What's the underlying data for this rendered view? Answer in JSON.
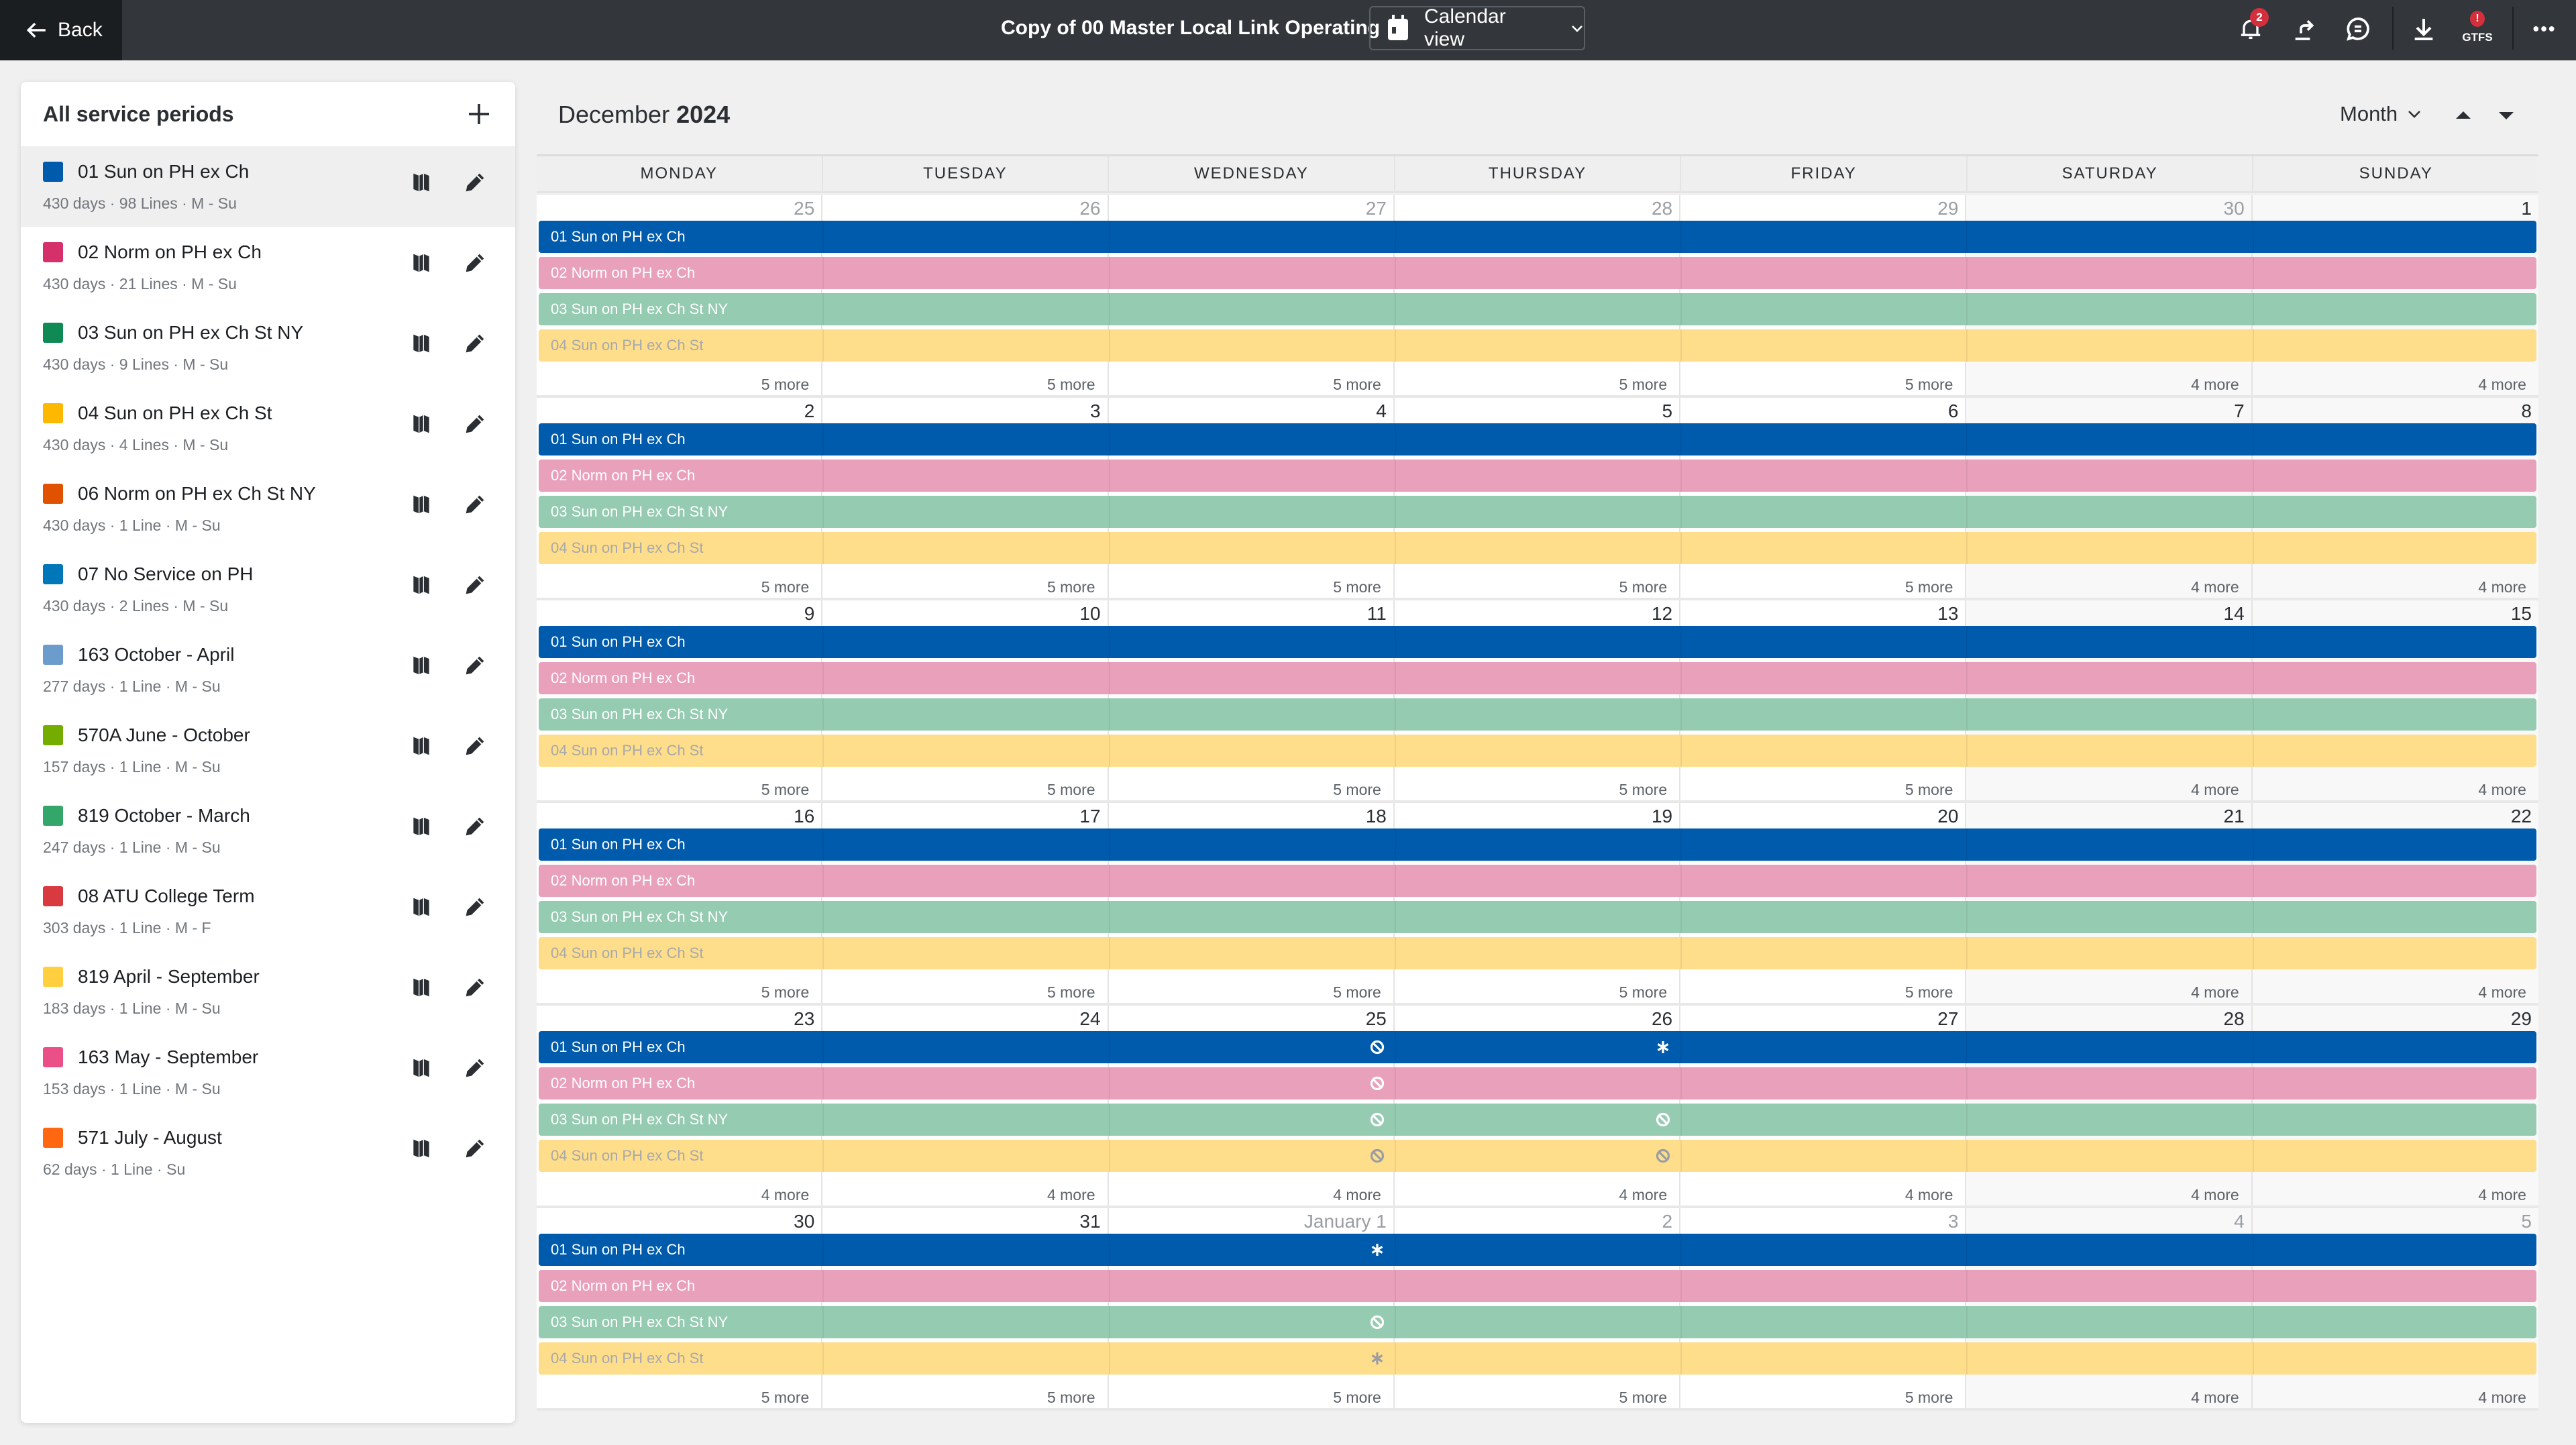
{
  "topbar": {
    "back_label": "Back",
    "doc_title": "Copy of 00 Master Local Link Operating",
    "view_label": "Calendar view",
    "notifications_count": "2",
    "gtfs_label": "GTFS",
    "gtfs_badge": "!",
    "icons": [
      "bell-icon",
      "share-icon",
      "comment-icon",
      "download-icon",
      "gtfs-icon",
      "more-icon"
    ]
  },
  "sidebar": {
    "title": "All service periods",
    "items": [
      {
        "name": "01 Sun on PH ex Ch",
        "meta": "430 days · 98 Lines · M - Su",
        "color": "#005bac",
        "selected": true
      },
      {
        "name": "02 Norm on PH ex Ch",
        "meta": "430 days · 21 Lines · M - Su",
        "color": "#d5306a"
      },
      {
        "name": "03 Sun on PH ex Ch St NY",
        "meta": "430 days · 9 Lines · M - Su",
        "color": "#0f8a55"
      },
      {
        "name": "04 Sun on PH ex Ch St",
        "meta": "430 days · 4 Lines · M - Su",
        "color": "#ffb800"
      },
      {
        "name": "06 Norm on PH ex Ch St NY",
        "meta": "430 days · 1 Line · M - Su",
        "color": "#e05200"
      },
      {
        "name": "07 No Service on PH",
        "meta": "430 days · 2 Lines · M - Su",
        "color": "#0077b8"
      },
      {
        "name": "163 October - April",
        "meta": "277 days · 1 Line · M - Su",
        "color": "#6b9ccb"
      },
      {
        "name": "570A June - October",
        "meta": "157 days · 1 Line · M - Su",
        "color": "#74ad00"
      },
      {
        "name": "819 October - March",
        "meta": "247 days · 1 Line · M - Su",
        "color": "#35a66a"
      },
      {
        "name": "08 ATU College Term",
        "meta": "303 days · 1 Line · M - F",
        "color": "#d93a3f"
      },
      {
        "name": "819 April - September",
        "meta": "183 days · 1 Line · M - Su",
        "color": "#ffcf3f"
      },
      {
        "name": "163 May - September",
        "meta": "153 days · 1 Line · M - Su",
        "color": "#ea4f88"
      },
      {
        "name": "571 July - August",
        "meta": "62 days · 1 Line · Su",
        "color": "#ff6711"
      }
    ]
  },
  "calendar": {
    "month": "December",
    "year": "2024",
    "view_select": "Month",
    "weekdays": [
      "MONDAY",
      "TUESDAY",
      "WEDNESDAY",
      "THURSDAY",
      "FRIDAY",
      "SATURDAY",
      "SUNDAY"
    ],
    "bars": [
      {
        "label": "01 Sun on PH ex Ch",
        "color": "#005bac",
        "text_color": "#ffffff",
        "mark_color": "#ffffff"
      },
      {
        "label": "02 Norm on PH ex Ch",
        "color": "#e9a1bb",
        "text_color": "#ffffff",
        "mark_color": "#ffffff"
      },
      {
        "label": "03 Sun on PH ex Ch St NY",
        "color": "#95cbb1",
        "text_color": "#ffffff",
        "mark_color": "#ffffff"
      },
      {
        "label": "04 Sun on PH ex Ch St",
        "color": "#fedd8b",
        "text_color": "#a7a9ab",
        "mark_color": "#9a9ea3"
      }
    ],
    "weeks": [
      {
        "days": [
          {
            "num": "25",
            "muted": true,
            "more": "5 more"
          },
          {
            "num": "26",
            "muted": true,
            "more": "5 more"
          },
          {
            "num": "27",
            "muted": true,
            "more": "5 more"
          },
          {
            "num": "28",
            "muted": true,
            "more": "5 more"
          },
          {
            "num": "29",
            "muted": true,
            "more": "5 more"
          },
          {
            "num": "30",
            "muted": true,
            "more": "4 more"
          },
          {
            "num": "1",
            "more": "4 more"
          }
        ]
      },
      {
        "days": [
          {
            "num": "2",
            "more": "5 more"
          },
          {
            "num": "3",
            "more": "5 more"
          },
          {
            "num": "4",
            "more": "5 more"
          },
          {
            "num": "5",
            "more": "5 more"
          },
          {
            "num": "6",
            "more": "5 more"
          },
          {
            "num": "7",
            "more": "4 more"
          },
          {
            "num": "8",
            "more": "4 more"
          }
        ]
      },
      {
        "days": [
          {
            "num": "9",
            "more": "5 more"
          },
          {
            "num": "10",
            "more": "5 more"
          },
          {
            "num": "11",
            "more": "5 more"
          },
          {
            "num": "12",
            "more": "5 more"
          },
          {
            "num": "13",
            "more": "5 more"
          },
          {
            "num": "14",
            "more": "4 more"
          },
          {
            "num": "15",
            "more": "4 more"
          }
        ]
      },
      {
        "days": [
          {
            "num": "16",
            "more": "5 more"
          },
          {
            "num": "17",
            "more": "5 more"
          },
          {
            "num": "18",
            "more": "5 more"
          },
          {
            "num": "19",
            "more": "5 more"
          },
          {
            "num": "20",
            "more": "5 more"
          },
          {
            "num": "21",
            "more": "4 more"
          },
          {
            "num": "22",
            "more": "4 more"
          }
        ]
      },
      {
        "days": [
          {
            "num": "23",
            "more": "4 more"
          },
          {
            "num": "24",
            "more": "4 more"
          },
          {
            "num": "25",
            "more": "4 more",
            "marks": [
              "no-service",
              "no-service",
              "no-service",
              "no-service"
            ]
          },
          {
            "num": "26",
            "more": "4 more",
            "marks": [
              "exception",
              null,
              "no-service",
              "no-service"
            ]
          },
          {
            "num": "27",
            "more": "4 more"
          },
          {
            "num": "28",
            "more": "4 more"
          },
          {
            "num": "29",
            "more": "4 more"
          }
        ]
      },
      {
        "days": [
          {
            "num": "30",
            "more": "5 more"
          },
          {
            "num": "31",
            "more": "5 more"
          },
          {
            "num": "January 1",
            "muted": true,
            "more": "5 more",
            "marks": [
              "exception",
              null,
              "no-service",
              "exception"
            ]
          },
          {
            "num": "2",
            "muted": true,
            "more": "5 more"
          },
          {
            "num": "3",
            "muted": true,
            "more": "5 more"
          },
          {
            "num": "4",
            "muted": true,
            "more": "4 more"
          },
          {
            "num": "5",
            "muted": true,
            "more": "4 more"
          }
        ]
      }
    ]
  }
}
